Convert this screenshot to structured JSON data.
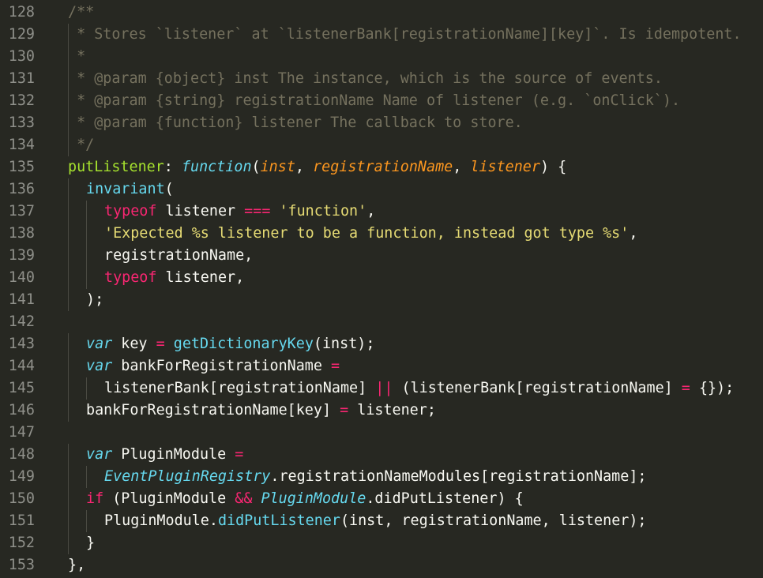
{
  "editor": {
    "theme_colors": {
      "background": "#272822",
      "foreground": "#f8f8f2",
      "comment": "#75715e",
      "function": "#a6e22e",
      "storage": "#66d9ef",
      "parameter": "#fd971f",
      "keyword": "#f92672",
      "string": "#e6db74",
      "line_number": "#8f908a"
    },
    "lines": [
      {
        "num": "128",
        "indent": 0,
        "tokens": [
          [
            "comment",
            "/**"
          ]
        ]
      },
      {
        "num": "129",
        "indent": 0,
        "tokens": [
          [
            "comment",
            " * Stores `listener` at `listenerBank[registrationName][key]`. Is idempotent."
          ]
        ]
      },
      {
        "num": "130",
        "indent": 0,
        "tokens": [
          [
            "comment",
            " *"
          ]
        ]
      },
      {
        "num": "131",
        "indent": 0,
        "tokens": [
          [
            "comment",
            " * @param {object} inst The instance, which is the source of events."
          ]
        ]
      },
      {
        "num": "132",
        "indent": 0,
        "tokens": [
          [
            "comment",
            " * @param {string} registrationName Name of listener (e.g. `onClick`)."
          ]
        ]
      },
      {
        "num": "133",
        "indent": 0,
        "tokens": [
          [
            "comment",
            " * @param {function} listener The callback to store."
          ]
        ]
      },
      {
        "num": "134",
        "indent": 0,
        "tokens": [
          [
            "comment",
            " */"
          ]
        ]
      },
      {
        "num": "135",
        "indent": 0,
        "tokens": [
          [
            "func",
            "putListener"
          ],
          [
            "plain",
            ": "
          ],
          [
            "store",
            "function"
          ],
          [
            "plain",
            "("
          ],
          [
            "param",
            "inst"
          ],
          [
            "plain",
            ", "
          ],
          [
            "param",
            "registrationName"
          ],
          [
            "plain",
            ", "
          ],
          [
            "param",
            "listener"
          ],
          [
            "plain",
            ") {"
          ]
        ]
      },
      {
        "num": "136",
        "indent": 1,
        "tokens": [
          [
            "store-plain",
            "invariant"
          ],
          [
            "plain",
            "("
          ]
        ]
      },
      {
        "num": "137",
        "indent": 2,
        "tokens": [
          [
            "kw",
            "typeof"
          ],
          [
            "plain",
            " listener "
          ],
          [
            "kw",
            "==="
          ],
          [
            "plain",
            " "
          ],
          [
            "str",
            "'function'"
          ],
          [
            "plain",
            ","
          ]
        ]
      },
      {
        "num": "138",
        "indent": 2,
        "tokens": [
          [
            "str",
            "'Expected %s listener to be a function, instead got type %s'"
          ],
          [
            "plain",
            ","
          ]
        ]
      },
      {
        "num": "139",
        "indent": 2,
        "tokens": [
          [
            "plain",
            "registrationName,"
          ]
        ]
      },
      {
        "num": "140",
        "indent": 2,
        "tokens": [
          [
            "kw",
            "typeof"
          ],
          [
            "plain",
            " listener,"
          ]
        ]
      },
      {
        "num": "141",
        "indent": 1,
        "tokens": [
          [
            "plain",
            ");"
          ]
        ]
      },
      {
        "num": "142",
        "indent": 0,
        "tokens": []
      },
      {
        "num": "143",
        "indent": 1,
        "tokens": [
          [
            "store",
            "var"
          ],
          [
            "plain",
            " key "
          ],
          [
            "kw",
            "="
          ],
          [
            "plain",
            " "
          ],
          [
            "store-plain",
            "getDictionaryKey"
          ],
          [
            "plain",
            "(inst);"
          ]
        ]
      },
      {
        "num": "144",
        "indent": 1,
        "tokens": [
          [
            "store",
            "var"
          ],
          [
            "plain",
            " bankForRegistrationName "
          ],
          [
            "kw",
            "="
          ]
        ]
      },
      {
        "num": "145",
        "indent": 2,
        "tokens": [
          [
            "plain",
            "listenerBank[registrationName] "
          ],
          [
            "kw",
            "||"
          ],
          [
            "plain",
            " (listenerBank[registrationName] "
          ],
          [
            "kw",
            "="
          ],
          [
            "plain",
            " {});"
          ]
        ]
      },
      {
        "num": "146",
        "indent": 1,
        "tokens": [
          [
            "plain",
            "bankForRegistrationName[key] "
          ],
          [
            "kw",
            "="
          ],
          [
            "plain",
            " listener;"
          ]
        ]
      },
      {
        "num": "147",
        "indent": 0,
        "tokens": []
      },
      {
        "num": "148",
        "indent": 1,
        "tokens": [
          [
            "store",
            "var"
          ],
          [
            "plain",
            " PluginModule "
          ],
          [
            "kw",
            "="
          ]
        ]
      },
      {
        "num": "149",
        "indent": 2,
        "tokens": [
          [
            "class",
            "EventPluginRegistry"
          ],
          [
            "plain",
            ".registrationNameModules[registrationName];"
          ]
        ]
      },
      {
        "num": "150",
        "indent": 1,
        "tokens": [
          [
            "kw",
            "if"
          ],
          [
            "plain",
            " (PluginModule "
          ],
          [
            "kw",
            "&&"
          ],
          [
            "plain",
            " "
          ],
          [
            "class",
            "PluginModule"
          ],
          [
            "plain",
            ".didPutListener) {"
          ]
        ]
      },
      {
        "num": "151",
        "indent": 2,
        "tokens": [
          [
            "plain",
            "PluginModule."
          ],
          [
            "store-plain",
            "didPutListener"
          ],
          [
            "plain",
            "(inst, registrationName, listener);"
          ]
        ]
      },
      {
        "num": "152",
        "indent": 1,
        "tokens": [
          [
            "plain",
            "}"
          ]
        ]
      },
      {
        "num": "153",
        "indent": 0,
        "tokens": [
          [
            "plain",
            "},"
          ]
        ]
      }
    ]
  }
}
